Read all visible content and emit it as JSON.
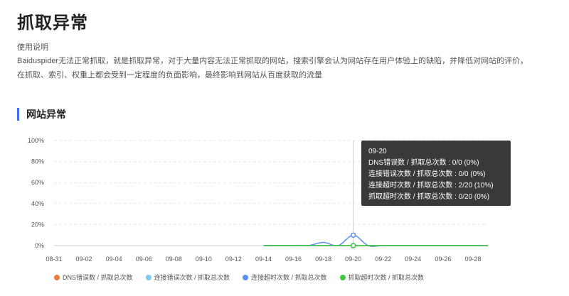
{
  "page": {
    "title": "抓取异常",
    "description_label": "使用说明",
    "description": "Baiduspider无法正常抓取，就是抓取异常，对于大量内容无法正常抓取的网站，搜索引擎会认为网站存在用户体验上的缺陷，并降低对网站的评价，在抓取、索引、权重上都会受到一定程度的负面影响，最终影响到网站从百度获取的流量"
  },
  "section": {
    "title": "网站异常"
  },
  "tooltip": {
    "date": "09-20",
    "lines": [
      "DNS错误数 / 抓取总次数 : 0/0 (0%)",
      "连接错误次数 / 抓取总次数 : 0/0 (0%)",
      "连接超时次数 / 抓取总次数 : 2/20 (10%)",
      "抓取超时次数 / 抓取总次数 : 0/20 (0%)"
    ]
  },
  "chart_data": {
    "type": "line",
    "x": [
      "08-31",
      "09-01",
      "09-02",
      "09-03",
      "09-04",
      "09-05",
      "09-06",
      "09-07",
      "09-08",
      "09-09",
      "09-10",
      "09-11",
      "09-12",
      "09-13",
      "09-14",
      "09-15",
      "09-16",
      "09-17",
      "09-18",
      "09-19",
      "09-20",
      "09-21",
      "09-22",
      "09-23",
      "09-24",
      "09-25",
      "09-26",
      "09-27",
      "09-28",
      "09-29"
    ],
    "xticks": [
      "08-31",
      "09-02",
      "09-04",
      "09-06",
      "09-08",
      "09-10",
      "09-12",
      "09-14",
      "09-16",
      "09-18",
      "09-20",
      "09-22",
      "09-24",
      "09-26",
      "09-28"
    ],
    "yticks": [
      "0%",
      "20%",
      "40%",
      "60%",
      "80%",
      "100%"
    ],
    "ylim": [
      0,
      100
    ],
    "series": [
      {
        "name": "DNS错误数 / 抓取总次数",
        "color": "#f07c3b",
        "start": "09-14",
        "values": [
          0,
          0,
          0,
          0,
          0,
          0,
          0,
          0,
          0,
          0,
          0,
          0,
          0,
          0,
          0,
          0
        ]
      },
      {
        "name": "连接错误次数 / 抓取总次数",
        "color": "#7ec8f0",
        "start": "09-14",
        "values": [
          0,
          0,
          0,
          0,
          0,
          0,
          0,
          0,
          0,
          0,
          0,
          0,
          0,
          0,
          0,
          0
        ]
      },
      {
        "name": "连接超时次数 / 抓取总次数",
        "color": "#5b8ff0",
        "start": "09-14",
        "values": [
          0,
          0,
          0,
          0,
          3,
          0,
          10,
          0,
          0,
          0,
          0,
          0,
          0,
          0,
          0,
          0
        ]
      },
      {
        "name": "抓取超时次数 / 抓取总次数",
        "color": "#3cc83c",
        "start": "09-14",
        "values": [
          0,
          0,
          0,
          0,
          0,
          0,
          0,
          0,
          0,
          0,
          0,
          0,
          0,
          0,
          0,
          0
        ]
      }
    ],
    "highlight": "09-20",
    "grid": true,
    "legend_position": "bottom"
  }
}
